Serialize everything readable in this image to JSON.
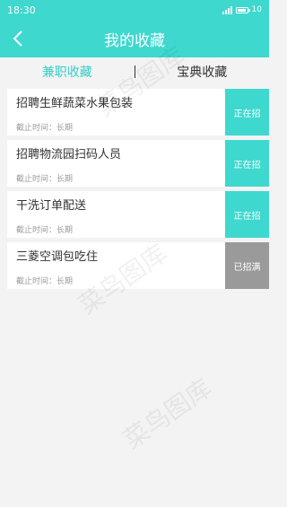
{
  "status_bar": {
    "time": "18:30",
    "battery_text": "10"
  },
  "header": {
    "title": "我的收藏",
    "back_icon": "chevron-left-icon"
  },
  "tabs": [
    {
      "label": "兼职收藏",
      "active": true
    },
    {
      "label": "宝典收藏",
      "active": false
    }
  ],
  "favorites": [
    {
      "title": "招聘生鲜蔬菜水果包装",
      "deadline": "截止时间：长期",
      "status": "正在招"
    },
    {
      "title": "招聘物流园扫码人员",
      "deadline": "截止时间：长期",
      "status": "正在招"
    },
    {
      "title": "干洗订单配送",
      "deadline": "截止时间：长期",
      "status": "正在招"
    },
    {
      "title": "三菱空调包吃住",
      "deadline": "截止时间：长期",
      "status": "已招满"
    }
  ],
  "colors": {
    "accent": "#3ed8cf",
    "closed": "#9a9a9a"
  },
  "watermark": "菜鸟图库"
}
